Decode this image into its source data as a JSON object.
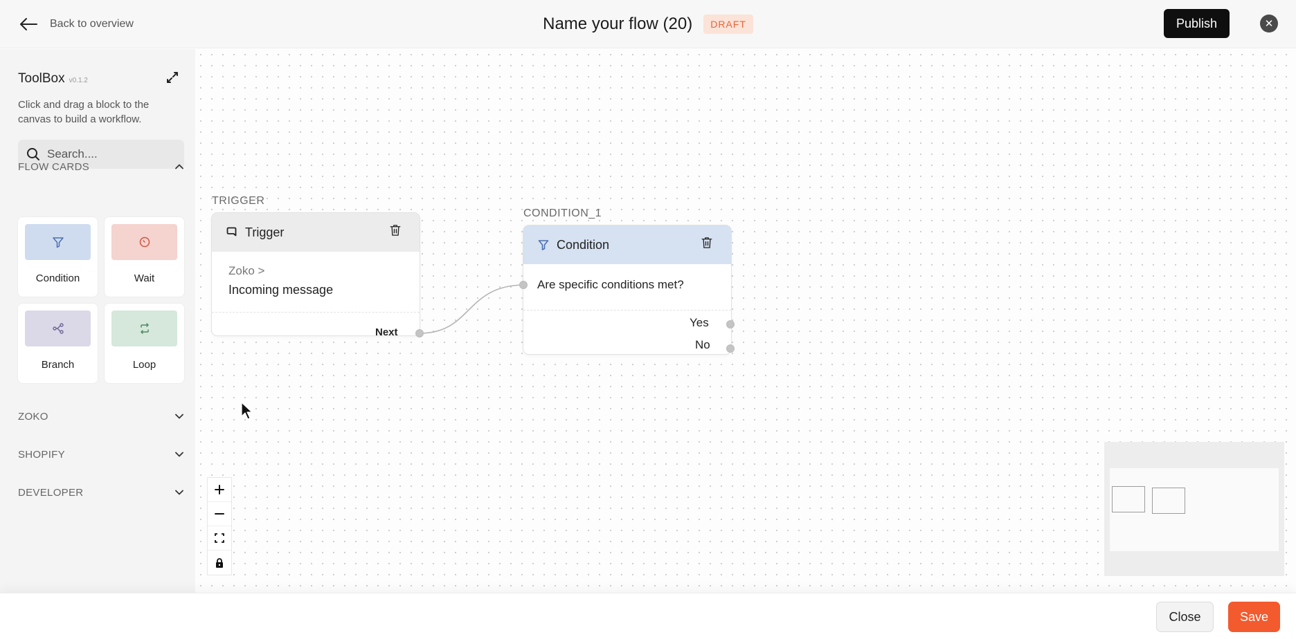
{
  "header": {
    "back_label": "Back to overview",
    "flow_title": "Name your flow (20)",
    "status_badge": "DRAFT",
    "publish_label": "Publish",
    "close_glyph": "✕"
  },
  "sidebar": {
    "title": "ToolBox",
    "version": "v0.1.2",
    "description": "Click and drag a block to the canvas to build a workflow.",
    "search_placeholder": "Search....",
    "search_value": "",
    "sections": {
      "flow_cards": {
        "label": "FLOW CARDS",
        "expanded": true
      },
      "zoko": {
        "label": "ZOKO",
        "expanded": false
      },
      "shopify": {
        "label": "SHOPIFY",
        "expanded": false
      },
      "developer": {
        "label": "DEVELOPER",
        "expanded": false
      }
    },
    "cards": [
      {
        "label": "Condition",
        "icon": "filter-icon",
        "color": "#cfdcef"
      },
      {
        "label": "Wait",
        "icon": "timer-icon",
        "color": "#f5d3cf"
      },
      {
        "label": "Branch",
        "icon": "branch-icon",
        "color": "#dbd8e8"
      },
      {
        "label": "Loop",
        "icon": "loop-icon",
        "color": "#d5e8db"
      }
    ]
  },
  "canvas": {
    "nodes": {
      "trigger": {
        "label": "TRIGGER",
        "title": "Trigger",
        "icon": "message-icon",
        "source": "Zoko >",
        "event": "Incoming message",
        "output_label": "Next",
        "header_color": "#ececec"
      },
      "condition": {
        "label": "CONDITION_1",
        "title": "Condition",
        "icon": "filter-icon",
        "question": "Are specific conditions met?",
        "outputs": [
          "Yes",
          "No"
        ],
        "header_color": "#d6e1f1"
      }
    }
  },
  "footer": {
    "close_label": "Close",
    "save_label": "Save"
  },
  "colors": {
    "accent": "#f35a2e",
    "draft_text": "#e6653a",
    "draft_bg": "#fbe3d8",
    "primary_button": "#0f0f0f"
  }
}
